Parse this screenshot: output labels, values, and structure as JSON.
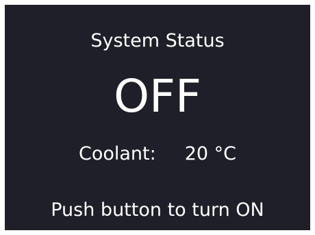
{
  "panel": {
    "title": "System Status",
    "state": "OFF",
    "coolant_label": "Coolant:",
    "coolant_value": "20 °C",
    "hint": "Push button to turn ON"
  },
  "colors": {
    "background": "#1f1f29",
    "text": "#ffffff",
    "frame": "#ffffff"
  }
}
